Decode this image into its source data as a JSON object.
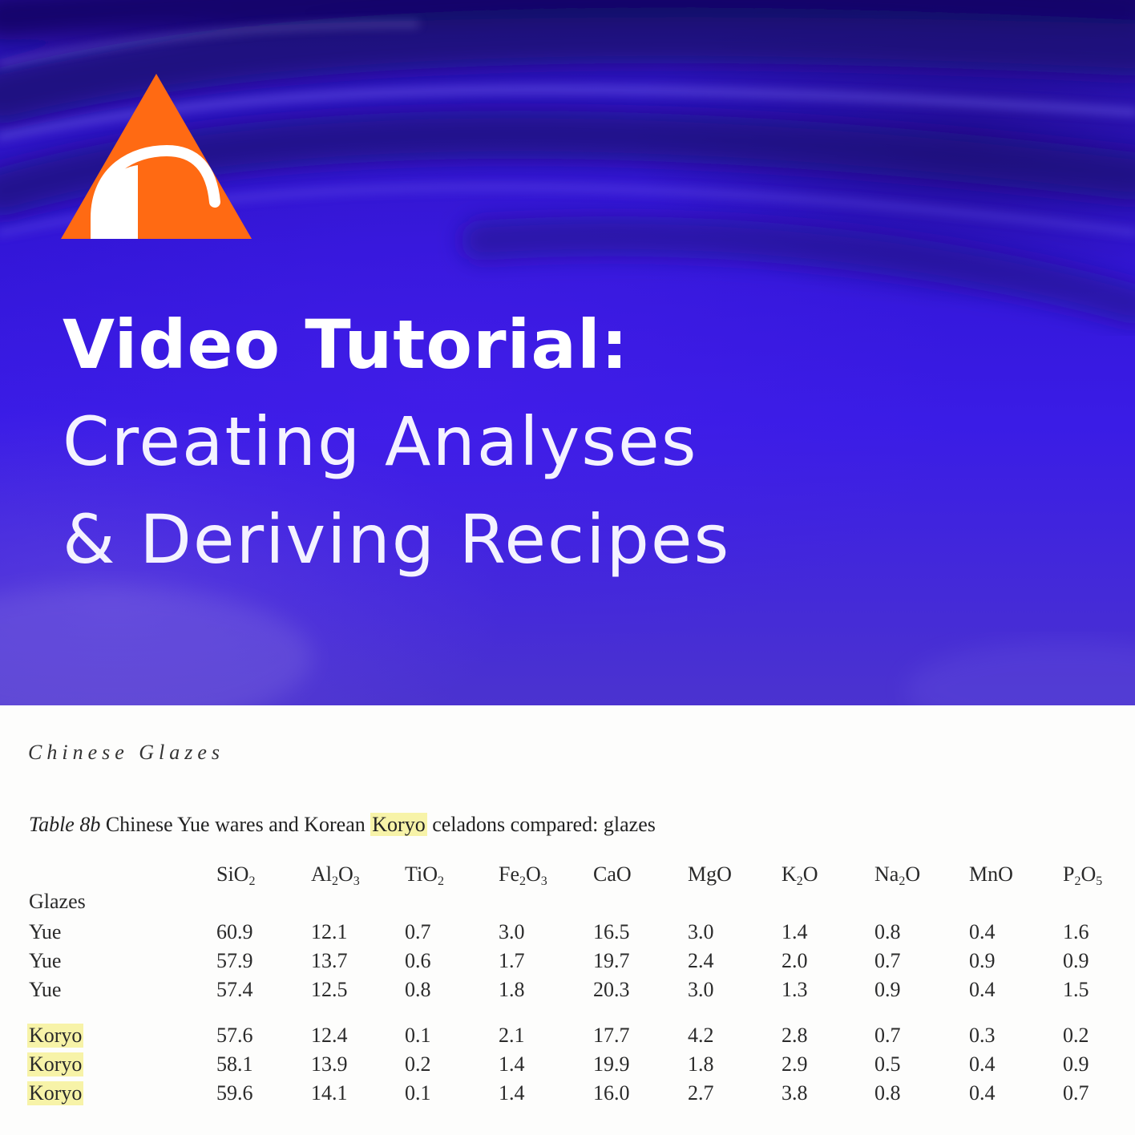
{
  "hero": {
    "title_line1": "Video Tutorial:",
    "title_line2": "Creating Analyses",
    "title_line3": "& Deriving Recipes",
    "colors": {
      "background": "#3316d8",
      "logo_orange": "#ff6a13",
      "text": "#ffffff"
    },
    "logo_icon": "orange-triangle-arch-logo"
  },
  "book": {
    "running_head": "Chinese Glazes",
    "caption_label": "Table 8b",
    "caption_pre": "Chinese Yue wares and Korean",
    "caption_highlight": "Koryo",
    "caption_post": "celadons compared: glazes",
    "highlight_color": "#f7f3a8",
    "row_group_label": "Glazes",
    "columns": [
      {
        "base": "SiO",
        "sub": "2",
        "tail": "",
        "tsub": ""
      },
      {
        "base": "Al",
        "sub": "2",
        "tail": "O",
        "tsub": "3"
      },
      {
        "base": "TiO",
        "sub": "2",
        "tail": "",
        "tsub": ""
      },
      {
        "base": "Fe",
        "sub": "2",
        "tail": "O",
        "tsub": "3"
      },
      {
        "base": "CaO",
        "sub": "",
        "tail": "",
        "tsub": ""
      },
      {
        "base": "MgO",
        "sub": "",
        "tail": "",
        "tsub": ""
      },
      {
        "base": "K",
        "sub": "2",
        "tail": "O",
        "tsub": ""
      },
      {
        "base": "Na",
        "sub": "2",
        "tail": "O",
        "tsub": ""
      },
      {
        "base": "MnO",
        "sub": "",
        "tail": "",
        "tsub": ""
      },
      {
        "base": "P",
        "sub": "2",
        "tail": "O",
        "tsub": "5"
      }
    ],
    "rows": [
      {
        "label": "Yue",
        "highlight": false,
        "values": [
          "60.9",
          "12.1",
          "0.7",
          "3.0",
          "16.5",
          "3.0",
          "1.4",
          "0.8",
          "0.4",
          "1.6"
        ]
      },
      {
        "label": "Yue",
        "highlight": false,
        "values": [
          "57.9",
          "13.7",
          "0.6",
          "1.7",
          "19.7",
          "2.4",
          "2.0",
          "0.7",
          "0.9",
          "0.9"
        ]
      },
      {
        "label": "Yue",
        "highlight": false,
        "values": [
          "57.4",
          "12.5",
          "0.8",
          "1.8",
          "20.3",
          "3.0",
          "1.3",
          "0.9",
          "0.4",
          "1.5"
        ]
      },
      {
        "label": "Koryo",
        "highlight": true,
        "values": [
          "57.6",
          "12.4",
          "0.1",
          "2.1",
          "17.7",
          "4.2",
          "2.8",
          "0.7",
          "0.3",
          "0.2"
        ]
      },
      {
        "label": "Koryo",
        "highlight": true,
        "values": [
          "58.1",
          "13.9",
          "0.2",
          "1.4",
          "19.9",
          "1.8",
          "2.9",
          "0.5",
          "0.4",
          "0.9"
        ]
      },
      {
        "label": "Koryo",
        "highlight": true,
        "values": [
          "59.6",
          "14.1",
          "0.1",
          "1.4",
          "16.0",
          "2.7",
          "3.8",
          "0.8",
          "0.4",
          "0.7"
        ]
      }
    ]
  }
}
